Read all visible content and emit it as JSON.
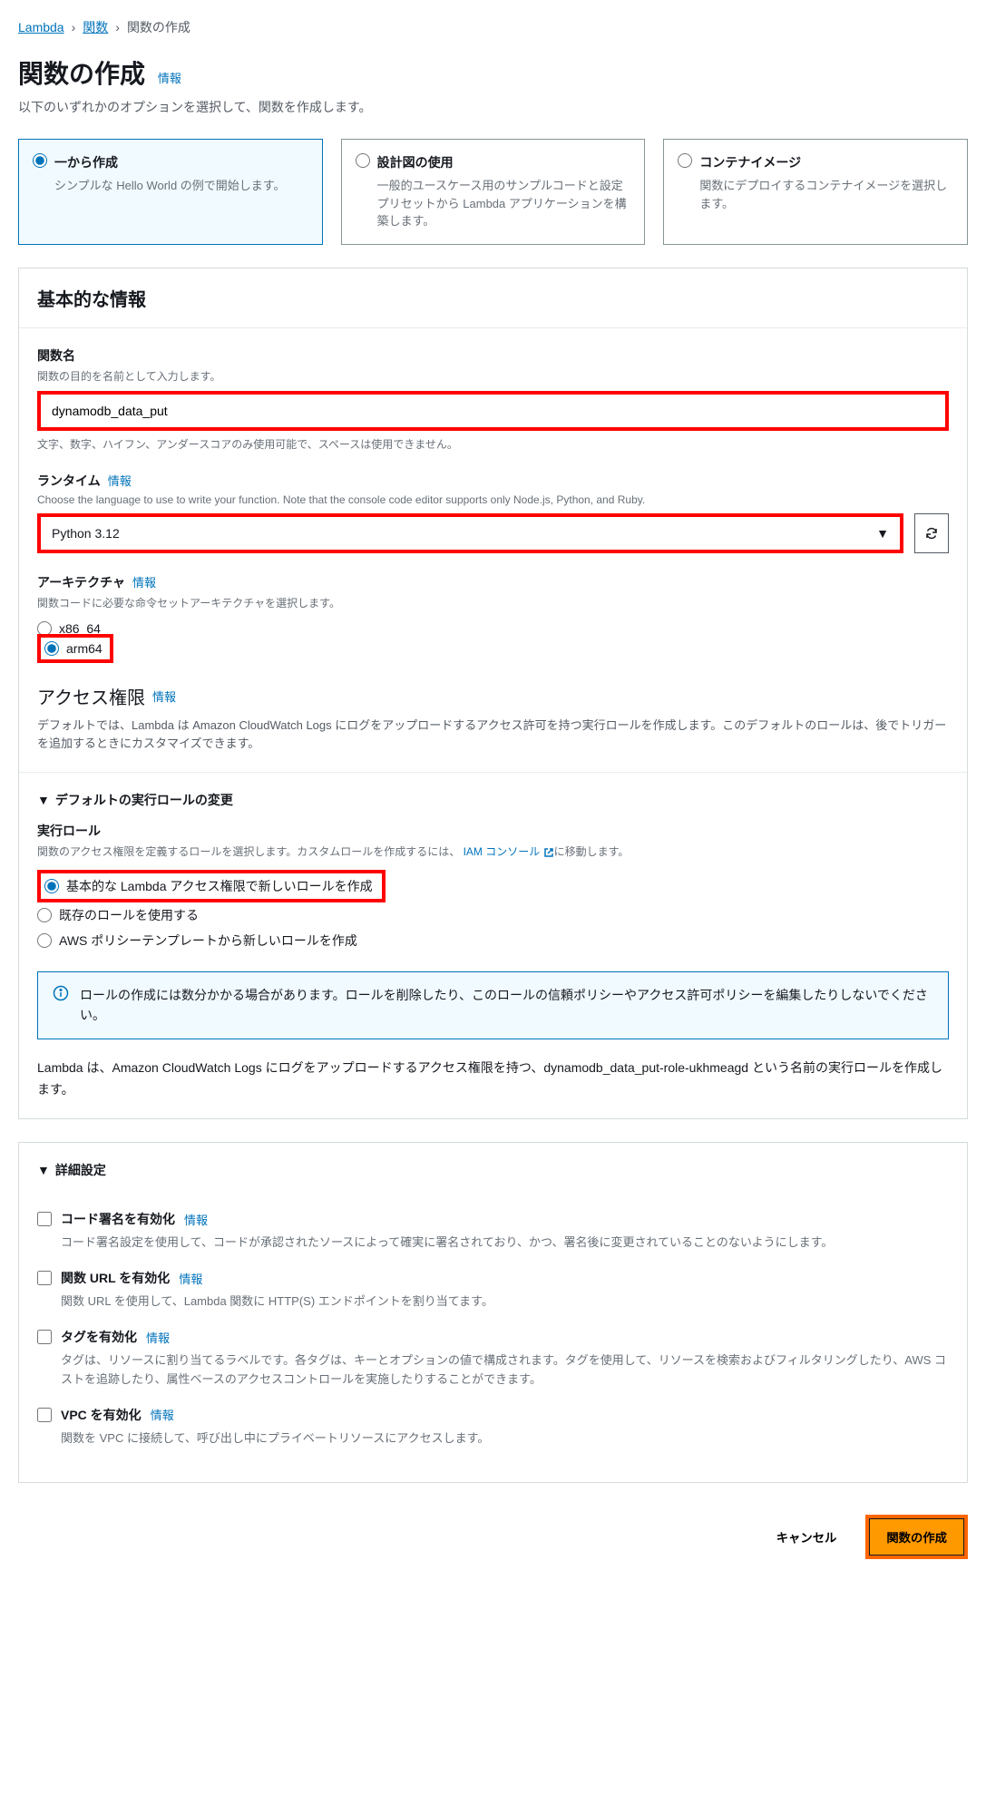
{
  "breadcrumb": {
    "root": "Lambda",
    "mid": "関数",
    "current": "関数の作成"
  },
  "header": {
    "title": "関数の作成",
    "info": "情報",
    "subtitle": "以下のいずれかのオプションを選択して、関数を作成します。"
  },
  "options": {
    "scratch": {
      "title": "一から作成",
      "desc": "シンプルな Hello World の例で開始します。"
    },
    "blueprint": {
      "title": "設計図の使用",
      "desc": "一般的ユースケース用のサンプルコードと設定プリセットから Lambda アプリケーションを構築します。"
    },
    "container": {
      "title": "コンテナイメージ",
      "desc": "関数にデプロイするコンテナイメージを選択します。"
    }
  },
  "basic": {
    "panel_title": "基本的な情報",
    "name_label": "関数名",
    "name_hint": "関数の目的を名前として入力します。",
    "name_value": "dynamodb_data_put",
    "name_sub": "文字、数字、ハイフン、アンダースコアのみ使用可能で、スペースは使用できません。",
    "runtime_label": "ランタイム",
    "runtime_info": "情報",
    "runtime_hint": "Choose the language to use to write your function. Note that the console code editor supports only Node.js, Python, and Ruby.",
    "runtime_value": "Python 3.12",
    "arch_label": "アーキテクチャ",
    "arch_info": "情報",
    "arch_hint": "関数コードに必要な命令セットアーキテクチャを選択します。",
    "arch_x86": "x86_64",
    "arch_arm": "arm64",
    "perm_title": "アクセス権限",
    "perm_info": "情報",
    "perm_desc": "デフォルトでは、Lambda は Amazon CloudWatch Logs にログをアップロードするアクセス許可を持つ実行ロールを作成します。このデフォルトのロールは、後でトリガーを追加するときにカスタマイズできます。"
  },
  "role": {
    "collapsible": "デフォルトの実行ロールの変更",
    "label": "実行ロール",
    "hint_pre": "関数のアクセス権限を定義するロールを選択します。カスタムロールを作成するには、",
    "hint_link": "IAM コンソール",
    "hint_post": "に移動します。",
    "opt_new": "基本的な Lambda アクセス権限で新しいロールを作成",
    "opt_existing": "既存のロールを使用する",
    "opt_template": "AWS ポリシーテンプレートから新しいロールを作成",
    "info_msg": "ロールの作成には数分かかる場合があります。ロールを削除したり、このロールの信頼ポリシーやアクセス許可ポリシーを編集したりしないでください。",
    "note": "Lambda は、Amazon CloudWatch Logs にログをアップロードするアクセス権限を持つ、dynamodb_data_put-role-ukhmeagd という名前の実行ロールを作成します。"
  },
  "advanced": {
    "panel_title": "詳細設定",
    "sign_label": "コード署名を有効化",
    "sign_info": "情報",
    "sign_desc": "コード署名設定を使用して、コードが承認されたソースによって確実に署名されており、かつ、署名後に変更されていることのないようにします。",
    "url_label": "関数 URL を有効化",
    "url_info": "情報",
    "url_desc": "関数 URL を使用して、Lambda 関数に HTTP(S) エンドポイントを割り当てます。",
    "tag_label": "タグを有効化",
    "tag_info": "情報",
    "tag_desc": "タグは、リソースに割り当てるラベルです。各タグは、キーとオプションの値で構成されます。タグを使用して、リソースを検索およびフィルタリングしたり、AWS コストを追跡したり、属性ベースのアクセスコントロールを実施したりすることができます。",
    "vpc_label": "VPC を有効化",
    "vpc_info": "情報",
    "vpc_desc": "関数を VPC に接続して、呼び出し中にプライベートリソースにアクセスします。"
  },
  "footer": {
    "cancel": "キャンセル",
    "create": "関数の作成"
  }
}
